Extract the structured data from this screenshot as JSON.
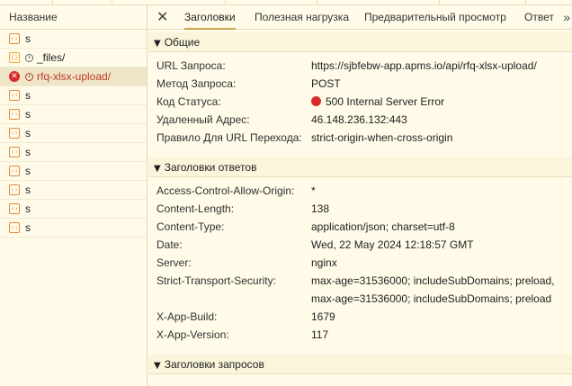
{
  "left_panel": {
    "header": "Название",
    "requests": [
      {
        "label": "s",
        "kind": "script"
      },
      {
        "label": "_files/",
        "kind": "js"
      },
      {
        "label": "rfq-xlsx-upload/",
        "kind": "error"
      },
      {
        "label": "s",
        "kind": "script"
      },
      {
        "label": "s",
        "kind": "script"
      },
      {
        "label": "s",
        "kind": "script"
      },
      {
        "label": "s",
        "kind": "script"
      },
      {
        "label": "s",
        "kind": "script"
      },
      {
        "label": "s",
        "kind": "script"
      },
      {
        "label": "s",
        "kind": "script"
      },
      {
        "label": "s",
        "kind": "script"
      }
    ]
  },
  "tabs": {
    "close": "✕",
    "items": [
      "Заголовки",
      "Полезная нагрузка",
      "Предварительный просмотр",
      "Ответ"
    ],
    "active": "Заголовки",
    "more": "»"
  },
  "general": {
    "title": "Общие",
    "rows": [
      {
        "k": "URL Запроса:",
        "v": "https://sjbfebw-app.apms.io/api/rfq-xlsx-upload/"
      },
      {
        "k": "Метод Запроса:",
        "v": "POST"
      },
      {
        "k": "Код Статуса:",
        "v": "500 Internal Server Error"
      },
      {
        "k": "Удаленный Адрес:",
        "v": "46.148.236.132:443"
      },
      {
        "k": "Правило Для URL Перехода:",
        "v": "strict-origin-when-cross-origin"
      }
    ]
  },
  "response_headers": {
    "title": "Заголовки ответов",
    "rows": [
      {
        "k": "Access-Control-Allow-Origin:",
        "v": "*"
      },
      {
        "k": "Content-Length:",
        "v": "138"
      },
      {
        "k": "Content-Type:",
        "v": "application/json; charset=utf-8"
      },
      {
        "k": "Date:",
        "v": "Wed, 22 May 2024 12:18:57 GMT"
      },
      {
        "k": "Server:",
        "v": "nginx"
      },
      {
        "k": "Strict-Transport-Security:",
        "v": "max-age=31536000; includeSubDomains; preload,",
        "v2": "max-age=31536000; includeSubDomains; preload"
      },
      {
        "k": "X-App-Build:",
        "v": "1679"
      },
      {
        "k": "X-App-Version:",
        "v": "117"
      }
    ]
  },
  "request_headers": {
    "title": "Заголовки запросов"
  },
  "colors": {
    "status_error": "#d62b2b",
    "active_tab_underline": "#c8a64a",
    "background": "#fffbe8"
  }
}
